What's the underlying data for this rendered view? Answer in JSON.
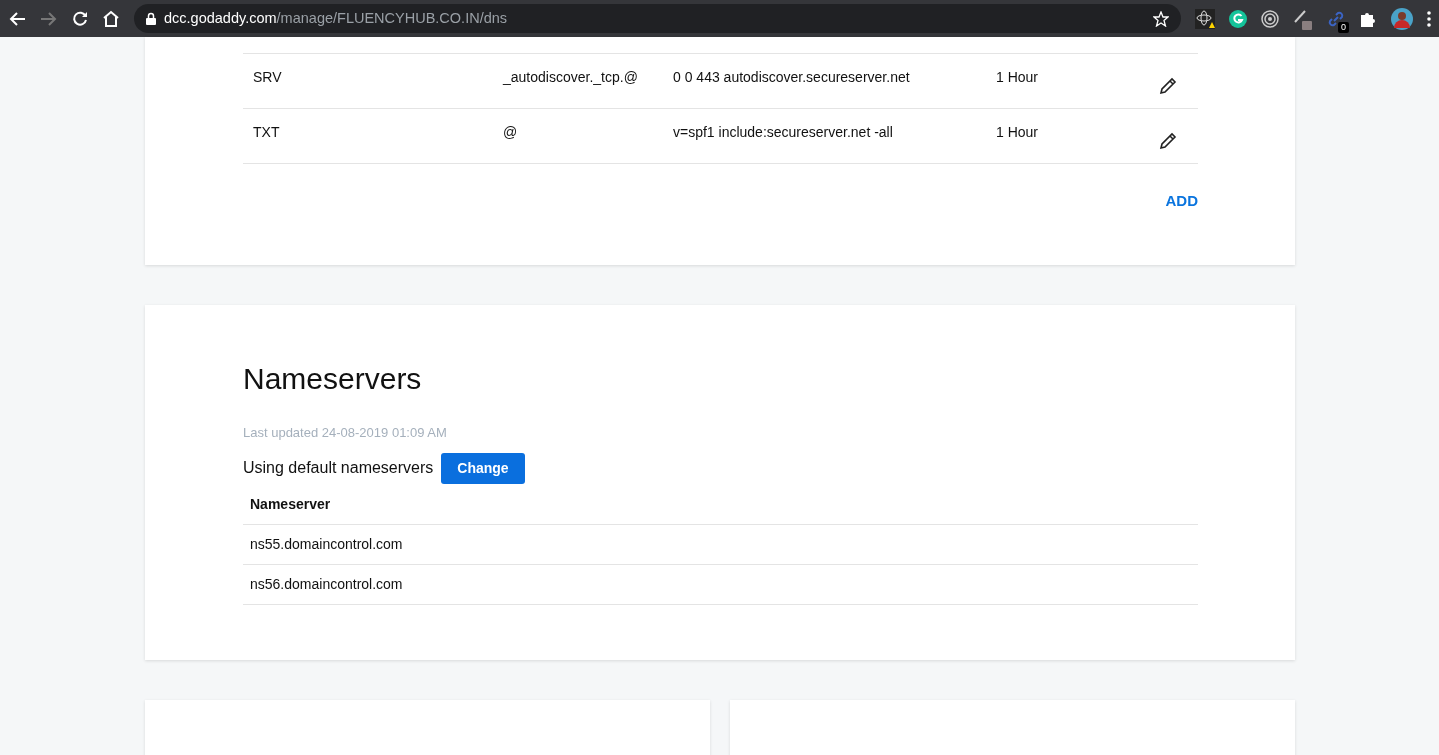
{
  "browser": {
    "url_host": "dcc.godaddy.com",
    "url_path": "/manage/FLUENCYHUB.CO.IN/dns",
    "forward_disabled": true,
    "extension_badge": "0"
  },
  "dns_records": {
    "rows": [
      {
        "type": "SRV",
        "name": "_autodiscover._tcp.@",
        "value": "0 0 443 autodiscover.secureserver.net",
        "ttl": "1 Hour"
      },
      {
        "type": "TXT",
        "name": "@",
        "value": "v=spf1 include:secureserver.net -all",
        "ttl": "1 Hour"
      }
    ],
    "add_label": "ADD"
  },
  "nameservers": {
    "title": "Nameservers",
    "last_updated": "Last updated 24-08-2019 01:09 AM",
    "status": "Using default nameservers",
    "change_button": "Change",
    "column": "Nameserver",
    "rows": [
      "ns55.domaincontrol.com",
      "ns56.domaincontrol.com"
    ]
  }
}
